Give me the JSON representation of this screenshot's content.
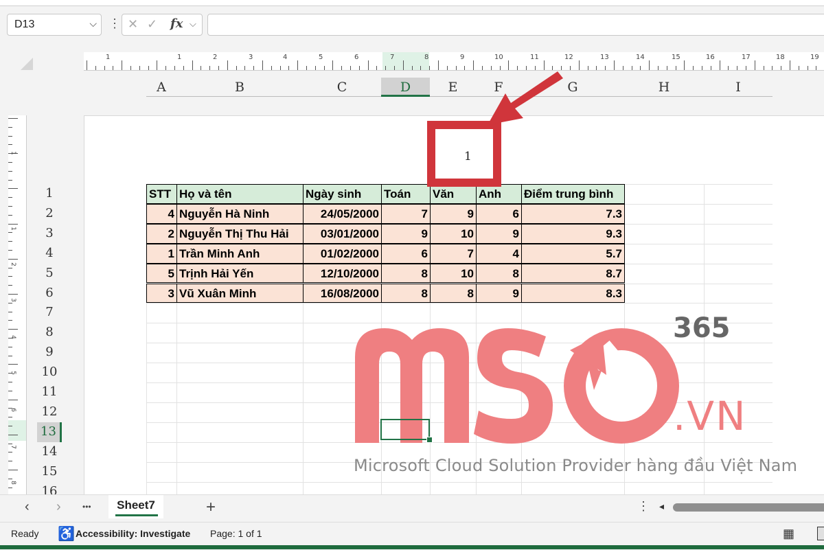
{
  "formula_bar": {
    "name_box": "D13",
    "fx": "fx",
    "cancel_icon": "✕",
    "enter_icon": "✓",
    "formula": ""
  },
  "ruler": {
    "h_numbers": [
      "1",
      "1",
      "2",
      "3",
      "4",
      "5",
      "6",
      "7",
      "8",
      "9",
      "10",
      "11",
      "12",
      "13",
      "14",
      "15",
      "16",
      "17",
      "18",
      "19"
    ],
    "v_numbers": [
      "1",
      "1",
      "2",
      "3",
      "4",
      "5",
      "6",
      "7",
      "8"
    ]
  },
  "columns": [
    "A",
    "B",
    "C",
    "D",
    "E",
    "F",
    "G",
    "H",
    "I"
  ],
  "rows": [
    "1",
    "2",
    "3",
    "4",
    "5",
    "6",
    "7",
    "8",
    "9",
    "10",
    "11",
    "12",
    "13",
    "14",
    "15",
    "16"
  ],
  "selected": {
    "column": "D",
    "row": "13"
  },
  "page_number": "1",
  "table": {
    "headers": [
      "STT",
      "Họ và tên",
      "Ngày sinh",
      "Toán",
      "Văn",
      "Anh",
      "Điểm trung bình"
    ],
    "rows": [
      [
        "4",
        "Nguyễn Hà Ninh",
        "24/05/2000",
        "7",
        "9",
        "6",
        "7.3"
      ],
      [
        "2",
        "Nguyễn Thị Thu Hải",
        "03/01/2000",
        "9",
        "10",
        "9",
        "9.3"
      ],
      [
        "1",
        "Trần Minh Anh",
        "01/02/2000",
        "6",
        "7",
        "4",
        "5.7"
      ],
      [
        "5",
        "Trịnh Hải Yến",
        "12/10/2000",
        "8",
        "10",
        "8",
        "8.7"
      ],
      [
        "3",
        "Vũ Xuân Minh",
        "16/08/2000",
        "8",
        "8",
        "9",
        "8.3"
      ]
    ]
  },
  "watermark": {
    "brand_365": "365",
    "domain": ".VN",
    "tagline": "Microsoft Cloud Solution Provider hàng đầu Việt Nam",
    "color": "#ef7f81"
  },
  "sheet_tabs": {
    "prev": "‹",
    "next": "›",
    "more": "•••",
    "active": "Sheet7",
    "add": "+",
    "menu": "⋮",
    "scroll_left": "◂"
  },
  "status_bar": {
    "ready": "Ready",
    "accessibility": "Accessibility: Investigate",
    "page": "Page: 1 of 1"
  },
  "colors": {
    "accent": "#217346",
    "header_fill": "#d6ecd9",
    "data_fill": "#fbe3d6",
    "callout": "#d0353b"
  }
}
